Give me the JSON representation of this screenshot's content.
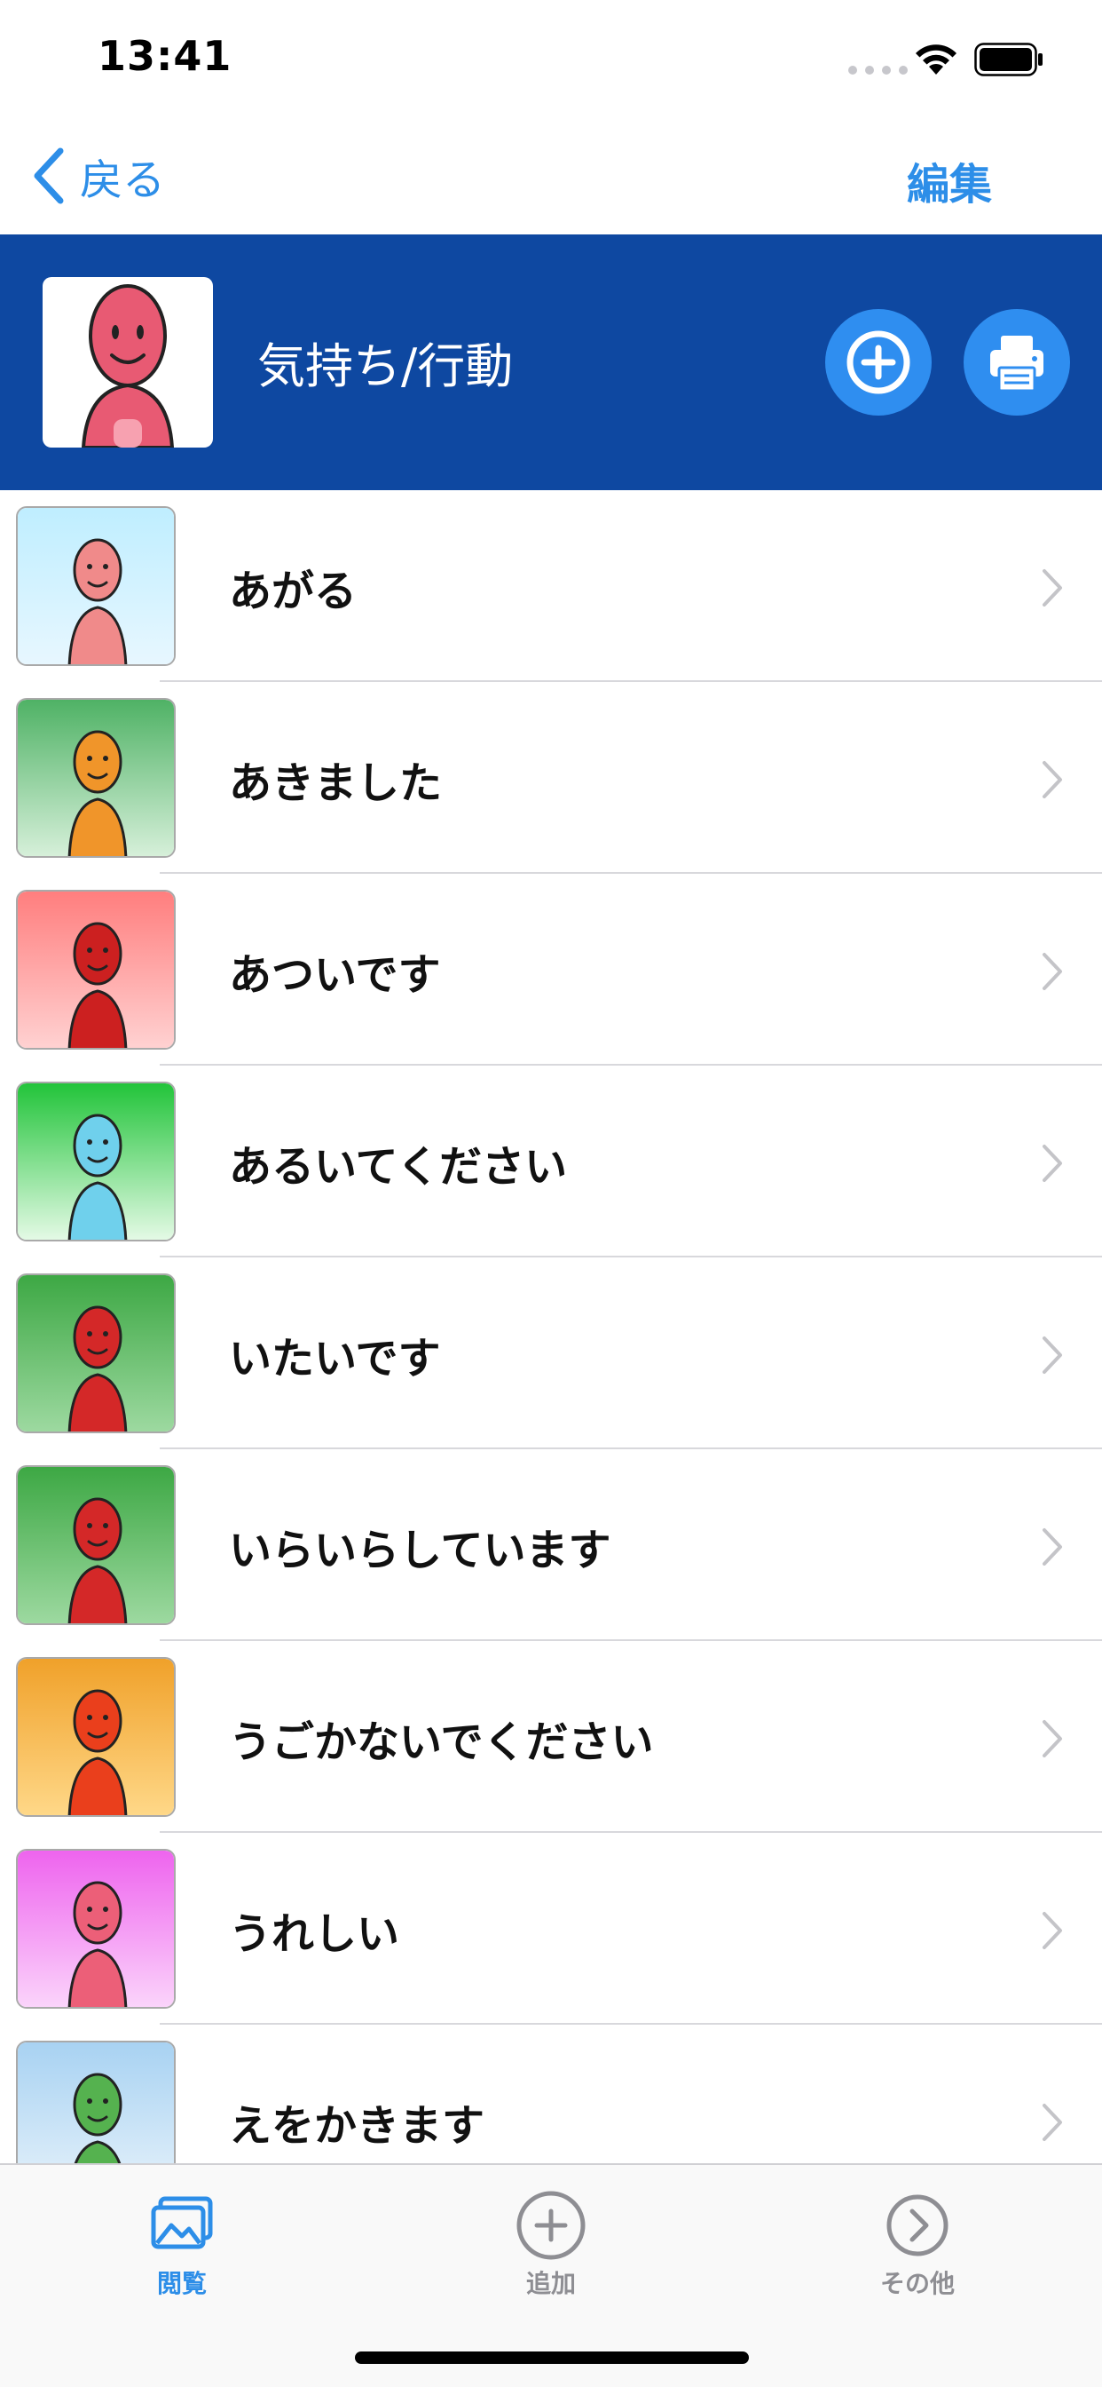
{
  "status_bar": {
    "time": "13:41"
  },
  "nav": {
    "back_label": "戻る",
    "edit_label": "編集"
  },
  "category": {
    "title": "気持ち/行動",
    "add_icon": "plus-circle-icon",
    "print_icon": "printer-icon"
  },
  "list": {
    "items": [
      {
        "label": "あがる",
        "bg_top": "#bfeeff",
        "bg_bottom": "#e8f7ff",
        "figure": "#f08a8a"
      },
      {
        "label": "あきました",
        "bg_top": "#4fb265",
        "bg_bottom": "#d9f1dc",
        "figure": "#f0952a"
      },
      {
        "label": "あついです",
        "bg_top": "#ff7e7e",
        "bg_bottom": "#ffd3d3",
        "figure": "#cc2020"
      },
      {
        "label": "あるいてください",
        "bg_top": "#22c43a",
        "bg_bottom": "#e8fbe9",
        "figure": "#6fd0ec"
      },
      {
        "label": "いたいです",
        "bg_top": "#3da844",
        "bg_bottom": "#9fdaa2",
        "figure": "#d42828"
      },
      {
        "label": "いらいらしています",
        "bg_top": "#3da844",
        "bg_bottom": "#9fdaa2",
        "figure": "#d42828"
      },
      {
        "label": "うごかないでください",
        "bg_top": "#f0a12a",
        "bg_bottom": "#ffd98a",
        "figure": "#ea3f1c"
      },
      {
        "label": "うれしい",
        "bg_top": "#ee64ee",
        "bg_bottom": "#fbd6fb",
        "figure": "#ec5f78"
      },
      {
        "label": "えをかきます",
        "bg_top": "#a8d2f2",
        "bg_bottom": "#e8f3fb",
        "figure": "#55b24f"
      }
    ]
  },
  "tab_bar": {
    "tabs": [
      {
        "label": "閲覧",
        "icon": "photos-icon",
        "active": true
      },
      {
        "label": "追加",
        "icon": "plus-circle-icon",
        "active": false
      },
      {
        "label": "その他",
        "icon": "chevron-right-circle-icon",
        "active": false
      }
    ]
  },
  "colors": {
    "accent": "#2d8ee8",
    "header_bg": "#0e48a1",
    "button_bg": "#2f8ef0"
  }
}
